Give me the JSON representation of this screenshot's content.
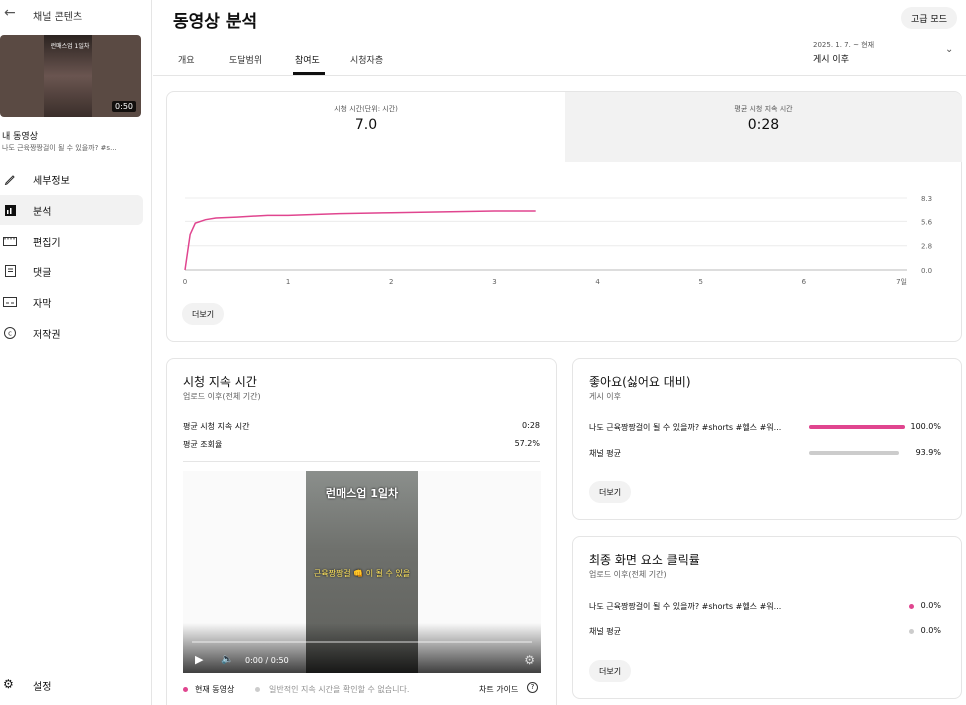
{
  "sidebar": {
    "back_label": "채널 콘텐츠",
    "thumbnail_title": "런매스업 1일차",
    "thumbnail_duration": "0:50",
    "my_video": "내 동영상",
    "video_title": "나도 근육짱짱걸이 될 수 있을까? #s...",
    "nav": [
      {
        "label": "세부정보",
        "icon": "pencil-icon"
      },
      {
        "label": "분석",
        "icon": "analytics-icon"
      },
      {
        "label": "편집기",
        "icon": "editor-icon"
      },
      {
        "label": "댓글",
        "icon": "comments-icon"
      },
      {
        "label": "자막",
        "icon": "subtitles-icon"
      },
      {
        "label": "저작권",
        "icon": "copyright-icon"
      }
    ],
    "settings": "설정"
  },
  "header": {
    "title": "동영상 분석",
    "advanced_mode": "고급 모드",
    "tabs": [
      "개요",
      "도달범위",
      "참여도",
      "시청자층"
    ],
    "active_tab": "참여도",
    "date_range": "2025. 1. 7. ~ 현재",
    "date_label": "게시 이후"
  },
  "metrics": {
    "watch_time_label": "시청 시간(단위: 시간)",
    "watch_time_value": "7.0",
    "avg_duration_label": "평균 시청 지속 시간",
    "avg_duration_value": "0:28"
  },
  "chart_data": {
    "type": "line",
    "x": [
      0,
      0.05,
      0.1,
      0.2,
      0.3,
      0.5,
      0.8,
      1,
      1.5,
      2,
      2.5,
      3,
      3.4
    ],
    "values": [
      0,
      4.1,
      5.4,
      5.8,
      6.0,
      6.1,
      6.3,
      6.3,
      6.5,
      6.6,
      6.7,
      6.8,
      6.8
    ],
    "x_ticks": [
      "0",
      "1",
      "2",
      "3",
      "4",
      "5",
      "6",
      "7일"
    ],
    "y_ticks": [
      "0.0",
      "2.8",
      "5.6",
      "8.3"
    ],
    "xlim": [
      0,
      7
    ],
    "ylim": [
      0,
      8.3
    ],
    "color": "#e0458f"
  },
  "more_label": "더보기",
  "watch_card": {
    "title": "시청 지속 시간",
    "subtitle": "업로드 이후(전체 기간)",
    "row1_label": "평균 시청 지속 시간",
    "row1_value": "0:28",
    "row2_label": "평균 조회율",
    "row2_value": "57.2%",
    "video_overlay_title": "런매스업 1일차",
    "video_overlay_sub": "근육짱짱걸 👊 이 될 수 있을",
    "player_time": "0:00 / 0:50",
    "legend_current": "현재 동영상",
    "legend_typical": "일반적인 지속 시간을 확인할 수 없습니다.",
    "chart_guide": "차트 가이드"
  },
  "like_card": {
    "title": "좋아요(싫어요 대비)",
    "subtitle": "게시 이후",
    "row1_label": "나도 근육짱짱걸이 될 수 있을까? #shorts #헬스 #워...",
    "row1_value": "100.0%",
    "row1_fraction": 1.0,
    "row2_label": "채널 평균",
    "row2_value": "93.9%",
    "row2_fraction": 0.939
  },
  "ctr_card": {
    "title": "최종 화면 요소 클릭률",
    "subtitle": "업로드 이후(전체 기간)",
    "row1_label": "나도 근육짱짱걸이 될 수 있을까? #shorts #헬스 #워...",
    "row1_value": "0.0%",
    "row2_label": "채널 평균",
    "row2_value": "0.0%"
  },
  "colors": {
    "accent": "#e0458f",
    "avg": "#cccccc"
  }
}
